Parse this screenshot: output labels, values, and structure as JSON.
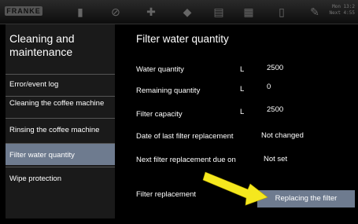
{
  "topbar": {
    "logo": "FRANKE",
    "clock_line1": "Mon 13:2",
    "clock_line2": "Next 4:55"
  },
  "sidebar": {
    "title": "Cleaning and maintenance",
    "items": [
      {
        "label": "Error/event log"
      },
      {
        "label": "Cleaning the coffee machine"
      },
      {
        "label": "Rinsing the coffee machine"
      },
      {
        "label": "Filter water quantity"
      },
      {
        "label": "Wipe protection"
      }
    ]
  },
  "main": {
    "title": "Filter water quantity",
    "rows": [
      {
        "label": "Water quantity",
        "unit": "L",
        "value": "2500"
      },
      {
        "label": "Remaining quantity",
        "unit": "L",
        "value": "0"
      },
      {
        "label": "Filter capacity",
        "unit": "L",
        "value": "2500"
      },
      {
        "label": "Date of last filter replacement",
        "value": "Not changed"
      },
      {
        "label": "Next filter replacement due on",
        "value": "Not set"
      }
    ],
    "replacement_label": "Filter replacement",
    "replace_button": "Replacing the filter"
  },
  "colors": {
    "active": "#6e7b8f",
    "arrow": "#f5e81e"
  }
}
